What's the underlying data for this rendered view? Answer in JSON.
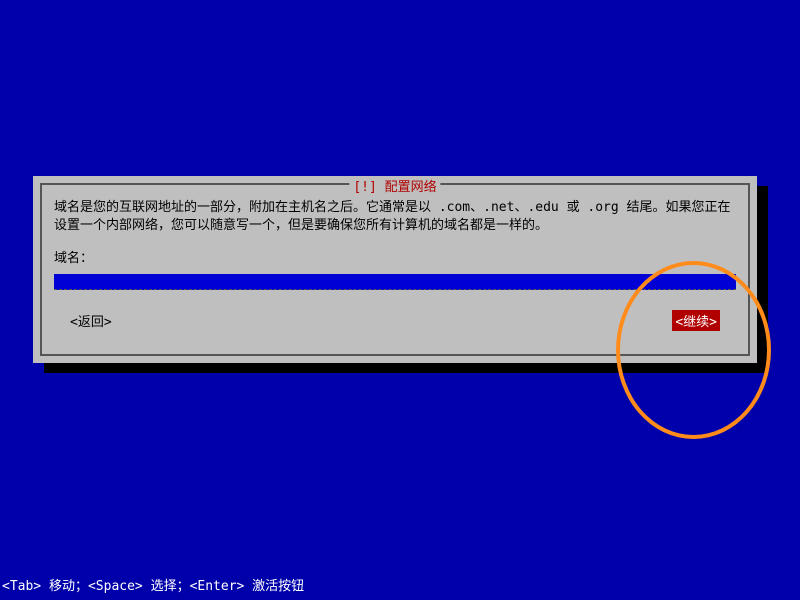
{
  "dialog": {
    "title": "[!] 配置网络",
    "description": "域名是您的互联网地址的一部分，附加在主机名之后。它通常是以 .com、.net、.edu 或 .org 结尾。如果您正在设置一个内部网络，您可以随意写一个，但是要确保您所有计算机的域名都是一样的。",
    "field_label": "域名：",
    "input_value": "",
    "back_label": "<返回>",
    "continue_label": "<继续>"
  },
  "footer": {
    "hint": "<Tab> 移动；<Space> 选择；<Enter> 激活按钮"
  }
}
